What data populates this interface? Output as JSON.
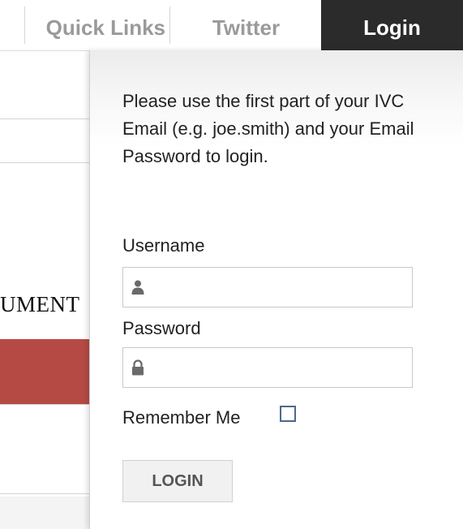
{
  "tabs": {
    "quick_links": "Quick Links",
    "twitter": "Twitter",
    "login": "Login"
  },
  "background": {
    "partial_text": "UMENT",
    "accent_color": "#b54a44"
  },
  "login_panel": {
    "instructions": "Please use the first part of your IVC Email (e.g. joe.smith) and your Email Password to login.",
    "username_label": "Username",
    "username_value": "",
    "username_icon": "user-icon",
    "password_label": "Password",
    "password_value": "",
    "password_icon": "lock-icon",
    "remember_label": "Remember Me",
    "remember_checked": false,
    "login_button": "LOGIN"
  }
}
